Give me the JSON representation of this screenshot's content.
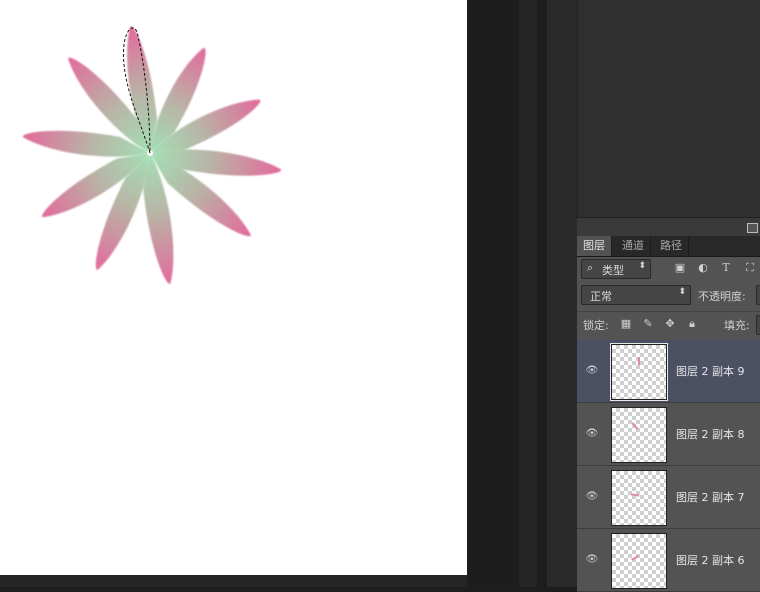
{
  "canvas": {
    "petal_outer_color": "#e06b9a",
    "petal_inner_color": "#9fe0b0",
    "petal_count": 10
  },
  "layers_panel": {
    "tabs": [
      {
        "label": "图层",
        "active": true
      },
      {
        "label": "通道",
        "active": false
      },
      {
        "label": "路径",
        "active": false
      }
    ],
    "filter": {
      "icon": "search-icon",
      "value": "类型"
    },
    "blend_mode": "正常",
    "opacity_label": "不透明度:",
    "lock_label": "锁定:",
    "fill_label": "填充:",
    "layers": [
      {
        "name": "图层 2 副本 9",
        "selected": true
      },
      {
        "name": "图层 2 副本 8",
        "selected": false
      },
      {
        "name": "图层 2 副本 7",
        "selected": false
      },
      {
        "name": "图层 2 副本 6",
        "selected": false
      }
    ]
  }
}
